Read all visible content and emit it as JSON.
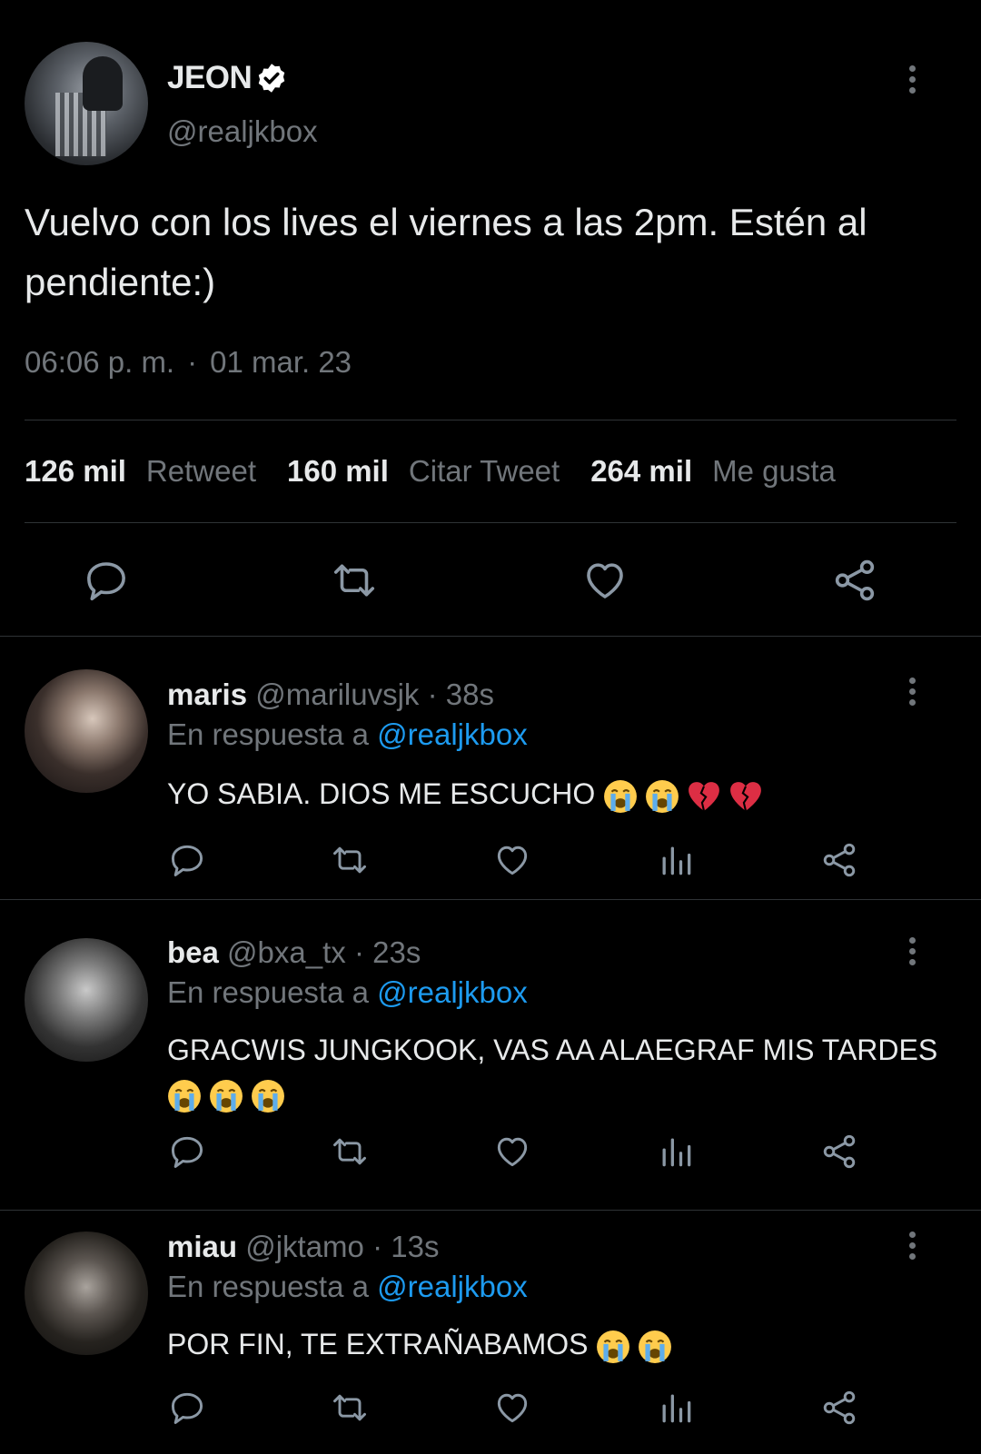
{
  "main_tweet": {
    "name": "JEON",
    "handle": "@realjkbox",
    "text": "Vuelvo con los lives el viernes a las 2pm. Estén al pendiente:)",
    "time": "06:06 p. m.",
    "separator": "·",
    "date": "01 mar. 23",
    "stats": [
      {
        "count": "126 mil",
        "label": "Retweet"
      },
      {
        "count": "160 mil",
        "label": "Citar Tweet"
      },
      {
        "count": "264 mil",
        "label": "Me gusta"
      }
    ]
  },
  "replies": [
    {
      "name": "maris",
      "handle": "@mariluvsjk",
      "age": "· 38s",
      "reply_prefix": "En respuesta a",
      "mention": "@realjkbox",
      "text": "YO SABIA. DIOS ME ESCUCHO",
      "emojis": [
        "loudly-crying-face",
        "loudly-crying-face",
        "broken-heart",
        "broken-heart"
      ]
    },
    {
      "name": "bea",
      "handle": "@bxa_tx",
      "age": "· 23s",
      "reply_prefix": "En respuesta a",
      "mention": "@realjkbox",
      "text": "GRACWIS JUNGKOOK, VAS AA ALAEGRAF MIS TARDES",
      "emojis": [
        "loudly-crying-face",
        "loudly-crying-face",
        "loudly-crying-face"
      ]
    },
    {
      "name": "miau",
      "handle": "@jktamo",
      "age": "· 13s",
      "reply_prefix": "En respuesta a",
      "mention": "@realjkbox",
      "text": "POR FIN, TE EXTRAÑABAMOS",
      "emojis": [
        "loudly-crying-face",
        "loudly-crying-face"
      ]
    }
  ],
  "colors": {
    "background": "#000000",
    "text": "#e7e9ea",
    "secondary": "#71767b",
    "link": "#1d9bf0",
    "divider": "#2f3336",
    "icon": "#8b98a5"
  }
}
